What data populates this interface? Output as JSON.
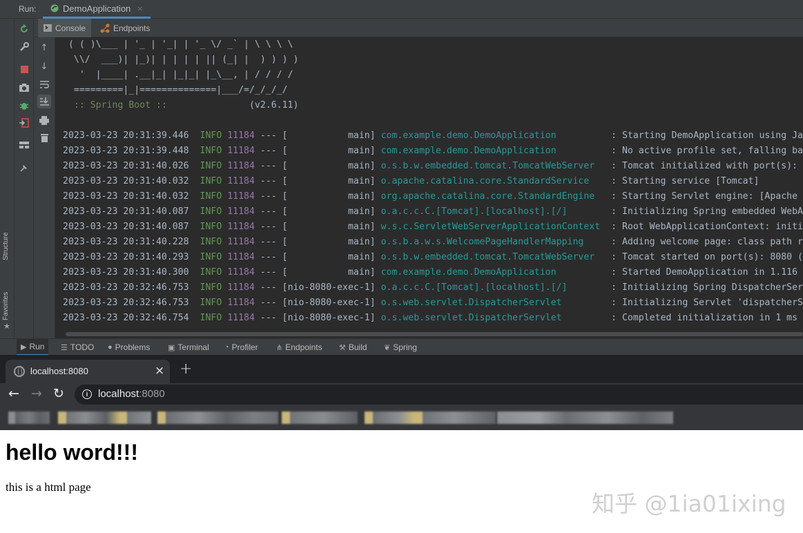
{
  "ide": {
    "run_label": "Run:",
    "run_tab": "DemoApplication",
    "run_tab_close": "×",
    "subtabs": [
      "Console",
      "Endpoints"
    ],
    "bottom_tabs": [
      "Run",
      "TODO",
      "Problems",
      "Terminal",
      "Profiler",
      "Endpoints",
      "Build",
      "Spring"
    ],
    "side_tabs": {
      "structure": "Structure",
      "favorites": "Favorites"
    },
    "console": {
      "banner": [
        " ( ( )\\___ | '_ | '_| | '_ \\/ _` | \\ \\ \\ \\",
        "  \\\\/  ___)| |_)| | | | | || (_| |  ) ) ) )",
        "   '  |____| .__|_| |_|_| |_\\__, | / / / /",
        "  =========|_|==============|___/=/_/_/_/"
      ],
      "spring_boot_label": "  :: Spring Boot ::",
      "spring_boot_version": "(v2.6.11)",
      "log_lines": [
        {
          "ts": "2023-03-23 20:31:39.446",
          "level": "INFO",
          "pid": "11184",
          "sep": "---",
          "thread": "[           main]",
          "logger": "com.example.demo.DemoApplication",
          "pad": "         ",
          "msg": ": Starting DemoApplication using Ja"
        },
        {
          "ts": "2023-03-23 20:31:39.448",
          "level": "INFO",
          "pid": "11184",
          "sep": "---",
          "thread": "[           main]",
          "logger": "com.example.demo.DemoApplication",
          "pad": "         ",
          "msg": ": No active profile set, falling ba"
        },
        {
          "ts": "2023-03-23 20:31:40.026",
          "level": "INFO",
          "pid": "11184",
          "sep": "---",
          "thread": "[           main]",
          "logger": "o.s.b.w.embedded.tomcat.TomcatWebServer",
          "pad": "  ",
          "msg": ": Tomcat initialized with port(s):"
        },
        {
          "ts": "2023-03-23 20:31:40.032",
          "level": "INFO",
          "pid": "11184",
          "sep": "---",
          "thread": "[           main]",
          "logger": "o.apache.catalina.core.StandardService",
          "pad": "   ",
          "msg": ": Starting service [Tomcat]"
        },
        {
          "ts": "2023-03-23 20:31:40.032",
          "level": "INFO",
          "pid": "11184",
          "sep": "---",
          "thread": "[           main]",
          "logger": "org.apache.catalina.core.StandardEngine",
          "pad": "  ",
          "msg": ": Starting Servlet engine: [Apache"
        },
        {
          "ts": "2023-03-23 20:31:40.087",
          "level": "INFO",
          "pid": "11184",
          "sep": "---",
          "thread": "[           main]",
          "logger": "o.a.c.c.C.[Tomcat].[localhost].[/]",
          "pad": "       ",
          "msg": ": Initializing Spring embedded WebA"
        },
        {
          "ts": "2023-03-23 20:31:40.087",
          "level": "INFO",
          "pid": "11184",
          "sep": "---",
          "thread": "[           main]",
          "logger": "w.s.c.ServletWebServerApplicationContext",
          "pad": " ",
          "msg": ": Root WebApplicationContext: initi"
        },
        {
          "ts": "2023-03-23 20:31:40.228",
          "level": "INFO",
          "pid": "11184",
          "sep": "---",
          "thread": "[           main]",
          "logger": "o.s.b.a.w.s.WelcomePageHandlerMapping",
          "pad": "    ",
          "msg": ": Adding welcome page: class path r"
        },
        {
          "ts": "2023-03-23 20:31:40.293",
          "level": "INFO",
          "pid": "11184",
          "sep": "---",
          "thread": "[           main]",
          "logger": "o.s.b.w.embedded.tomcat.TomcatWebServer",
          "pad": "  ",
          "msg": ": Tomcat started on port(s): 8080 ("
        },
        {
          "ts": "2023-03-23 20:31:40.300",
          "level": "INFO",
          "pid": "11184",
          "sep": "---",
          "thread": "[           main]",
          "logger": "com.example.demo.DemoApplication",
          "pad": "         ",
          "msg": ": Started DemoApplication in 1.116"
        },
        {
          "ts": "2023-03-23 20:32:46.753",
          "level": "INFO",
          "pid": "11184",
          "sep": "---",
          "thread": "[nio-8080-exec-1]",
          "logger": "o.a.c.c.C.[Tomcat].[localhost].[/]",
          "pad": "       ",
          "msg": ": Initializing Spring DispatcherSer"
        },
        {
          "ts": "2023-03-23 20:32:46.753",
          "level": "INFO",
          "pid": "11184",
          "sep": "---",
          "thread": "[nio-8080-exec-1]",
          "logger": "o.s.web.servlet.DispatcherServlet",
          "pad": "        ",
          "msg": ": Initializing Servlet 'dispatcherS"
        },
        {
          "ts": "2023-03-23 20:32:46.754",
          "level": "INFO",
          "pid": "11184",
          "sep": "---",
          "thread": "[nio-8080-exec-1]",
          "logger": "o.s.web.servlet.DispatcherServlet",
          "pad": "        ",
          "msg": ": Completed initialization in 1 ms"
        }
      ]
    },
    "colors": {
      "background": "#2b2b2b",
      "toolbar": "#3c3f41",
      "info": "#629755",
      "pid": "#9876aa",
      "logger": "#299999",
      "text": "#a9b7c6",
      "spring": "#6a8759"
    }
  },
  "browser": {
    "tab_title": "localhost:8080",
    "tab_close": "×",
    "new_tab": "+",
    "nav": {
      "back": "←",
      "forward": "→",
      "reload": "↻"
    },
    "url_host": "localhost",
    "url_port": ":8080",
    "info_icon_glyph": "i"
  },
  "page": {
    "heading": "hello word!!!",
    "paragraph": "this is a html page",
    "watermark": "知乎 @1ia01ixing"
  }
}
